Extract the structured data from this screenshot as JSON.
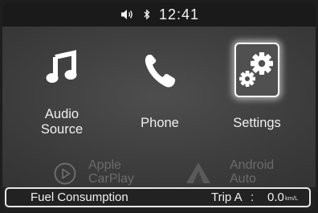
{
  "status_bar": {
    "time": "12:41",
    "icons": [
      "speaker-volume-icon",
      "bluetooth-icon"
    ]
  },
  "menu": {
    "items": [
      {
        "id": "audio",
        "label": "Audio\nSource",
        "icon": "music-note-icon",
        "selected": false
      },
      {
        "id": "phone",
        "label": "Phone",
        "icon": "phone-handset-icon",
        "selected": false
      },
      {
        "id": "settings",
        "label": "Settings",
        "icon": "gears-icon",
        "selected": true
      }
    ],
    "disabled_items": [
      {
        "id": "apple-carplay",
        "label": "Apple\nCarPlay",
        "icon": "carplay-play-icon"
      },
      {
        "id": "android-auto",
        "label": "Android\nAuto",
        "icon": "android-auto-icon"
      }
    ]
  },
  "fuel_bar": {
    "label": "Fuel Consumption",
    "trip_label": "Trip A",
    "separator": ":",
    "value": "0.0",
    "unit": "km/L"
  },
  "colors": {
    "background": "#3a3a3a",
    "status_bar": "#1a1a1a",
    "text": "#f0f0f0",
    "disabled_text": "#6b6b6b",
    "selection_glow": "#ffffff"
  }
}
